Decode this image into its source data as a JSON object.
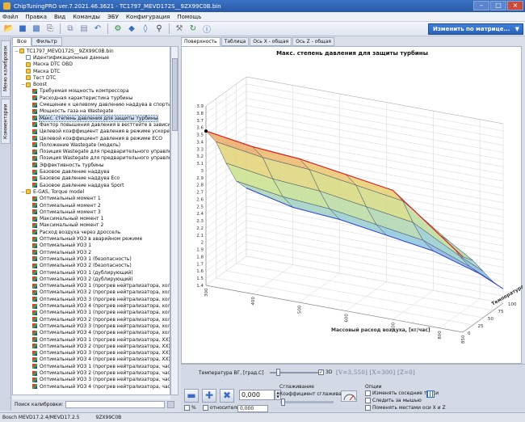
{
  "window": {
    "title": "ChipTuningPRO ver.7.2021.46.3621 - TC1797_MEVD172S__9ZX99C0B.bin"
  },
  "menu": [
    "Файл",
    "Правка",
    "Вид",
    "Команды",
    "ЭБУ",
    "Конфигурация",
    "Помощь"
  ],
  "toolbar": {
    "icons": [
      "open-folder-icon",
      "save-icon",
      "save-as-icon",
      "print-icon",
      "copy-icon",
      "paste-icon",
      "undo-icon",
      "connect-icon",
      "checksum-icon",
      "compare-icon",
      "search-icon",
      "settings-icon",
      "refresh-icon",
      "help-icon"
    ],
    "change_matrix_label": "Изменить по матрице..."
  },
  "side_tabs": [
    "Меню калибровок",
    "Комментарии"
  ],
  "left_tabs": [
    "Все",
    "Фильтр"
  ],
  "tree": [
    {
      "label": "TC1797_MEVD172S__9ZX99C0B.bin",
      "level": 0,
      "icon": "folder",
      "exp": "−"
    },
    {
      "label": "Идентификационные данные",
      "level": 1,
      "icon": "doc",
      "exp": ""
    },
    {
      "label": "Маска DTC OBD",
      "level": 1,
      "icon": "folder",
      "exp": ""
    },
    {
      "label": "Маска DTC",
      "level": 1,
      "icon": "folder",
      "exp": ""
    },
    {
      "label": "Тест DTC",
      "level": 1,
      "icon": "folder",
      "exp": ""
    },
    {
      "label": "Boost",
      "level": 1,
      "icon": "folder",
      "exp": "−"
    },
    {
      "label": "Требуемая мощность компрессора",
      "level": 2,
      "icon": "map",
      "exp": ""
    },
    {
      "label": "Расходная характеристика турбины",
      "level": 2,
      "icon": "map",
      "exp": ""
    },
    {
      "label": "Смещение к целевому давлению наддува в спортивном р",
      "level": 2,
      "icon": "map",
      "exp": ""
    },
    {
      "label": "Мощность газа на Wastegate",
      "level": 2,
      "icon": "map",
      "exp": ""
    },
    {
      "label": "Макс. степень давления для защиты турбины",
      "level": 2,
      "icon": "map",
      "exp": "",
      "selected": true
    },
    {
      "label": "Фактор повышения давления в вестгейте в зависимости",
      "level": 2,
      "icon": "map",
      "exp": ""
    },
    {
      "label": "Целевой коэффициент давления в режиме ускорения",
      "level": 2,
      "icon": "map",
      "exp": ""
    },
    {
      "label": "Целевой коэффициент давления в режиме ECO",
      "level": 2,
      "icon": "map",
      "exp": ""
    },
    {
      "label": "Положение Wastegate (модель)",
      "level": 2,
      "icon": "map",
      "exp": ""
    },
    {
      "label": "Позиция Wastegate для предварительного управления",
      "level": 2,
      "icon": "map",
      "exp": ""
    },
    {
      "label": "Позиция Wastegate для предварительного управления В",
      "level": 2,
      "icon": "map",
      "exp": ""
    },
    {
      "label": "Эффективность турбины",
      "level": 2,
      "icon": "map",
      "exp": ""
    },
    {
      "label": "Базовое давление наддува",
      "level": 2,
      "icon": "map",
      "exp": ""
    },
    {
      "label": "Базовое давление наддува Eco",
      "level": 2,
      "icon": "map",
      "exp": ""
    },
    {
      "label": "Базовое давление наддува Sport",
      "level": 2,
      "icon": "map",
      "exp": ""
    },
    {
      "label": "E-GAS, Torque model",
      "level": 1,
      "icon": "folder",
      "exp": "−"
    },
    {
      "label": "Оптимальный момент 1",
      "level": 2,
      "icon": "map",
      "exp": ""
    },
    {
      "label": "Оптимальный момент 2",
      "level": 2,
      "icon": "map",
      "exp": ""
    },
    {
      "label": "Оптимальный момент 3",
      "level": 2,
      "icon": "map",
      "exp": ""
    },
    {
      "label": "Максимальный момент 1",
      "level": 2,
      "icon": "map",
      "exp": ""
    },
    {
      "label": "Максимальный момент 2",
      "level": 2,
      "icon": "map",
      "exp": ""
    },
    {
      "label": "Расход воздуха через дроссель",
      "level": 2,
      "icon": "map",
      "exp": ""
    },
    {
      "label": "Оптимальный УОЗ в аварийном режиме",
      "level": 2,
      "icon": "map",
      "exp": ""
    },
    {
      "label": "Оптимальный УОЗ 1",
      "level": 2,
      "icon": "map",
      "exp": ""
    },
    {
      "label": "Оптимальный УОЗ 2",
      "level": 2,
      "icon": "map",
      "exp": ""
    },
    {
      "label": "Оптимальный УОЗ 1 (безопасность)",
      "level": 2,
      "icon": "map",
      "exp": ""
    },
    {
      "label": "Оптимальный УОЗ 2 (безопасность)",
      "level": 2,
      "icon": "map",
      "exp": ""
    },
    {
      "label": "Оптимальный УОЗ 1 (дублирующий)",
      "level": 2,
      "icon": "map",
      "exp": ""
    },
    {
      "label": "Оптимальный УОЗ 2 (дублирующий)",
      "level": 2,
      "icon": "map",
      "exp": ""
    },
    {
      "label": "Оптимальный УОЗ 1 (прогрев нейтрализатора, холодны",
      "level": 2,
      "icon": "map",
      "exp": ""
    },
    {
      "label": "Оптимальный УОЗ 2 (прогрев нейтрализатора, холодны",
      "level": 2,
      "icon": "map",
      "exp": ""
    },
    {
      "label": "Оптимальный УОЗ 3 (прогрев нейтрализатора, холодны",
      "level": 2,
      "icon": "map",
      "exp": ""
    },
    {
      "label": "Оптимальный УОЗ 4 (прогрев нейтрализатора, холодны",
      "level": 2,
      "icon": "map",
      "exp": ""
    },
    {
      "label": "Оптимальный УОЗ 1 (прогрев нейтрализатора, холодны",
      "level": 2,
      "icon": "map",
      "exp": ""
    },
    {
      "label": "Оптимальный УОЗ 2 (прогрев нейтрализатора, холодны",
      "level": 2,
      "icon": "map",
      "exp": ""
    },
    {
      "label": "Оптимальный УОЗ 3 (прогрев нейтрализатора, холодны",
      "level": 2,
      "icon": "map",
      "exp": ""
    },
    {
      "label": "Оптимальный УОЗ 4 (прогрев нейтрализатора, холодны",
      "level": 2,
      "icon": "map",
      "exp": ""
    },
    {
      "label": "Оптимальный УОЗ 1 (прогрев нейтрализатора, ХХ)",
      "level": 2,
      "icon": "map",
      "exp": ""
    },
    {
      "label": "Оптимальный УОЗ 2 (прогрев нейтрализатора, ХХ)",
      "level": 2,
      "icon": "map",
      "exp": ""
    },
    {
      "label": "Оптимальный УОЗ 3 (прогрев нейтрализатора, ХХ)",
      "level": 2,
      "icon": "map",
      "exp": ""
    },
    {
      "label": "Оптимальный УОЗ 4 (прогрев нейтрализатора, ХХ)",
      "level": 2,
      "icon": "map",
      "exp": ""
    },
    {
      "label": "Оптимальный УОЗ 1 (прогрев нейтрализатора, частична",
      "level": 2,
      "icon": "map",
      "exp": ""
    },
    {
      "label": "Оптимальный УОЗ 2 (прогрев нейтрализатора, частична",
      "level": 2,
      "icon": "map",
      "exp": ""
    },
    {
      "label": "Оптимальный УОЗ 3 (прогрев нейтрализатора, частична",
      "level": 2,
      "icon": "map",
      "exp": ""
    },
    {
      "label": "Оптимальный УОЗ 4 (прогрев нейтрализатора, частична",
      "level": 2,
      "icon": "map",
      "exp": ""
    }
  ],
  "search": {
    "label": "Поиск калибровки:",
    "value": ""
  },
  "view_tabs": [
    "Поверхность",
    "Таблица",
    "Ось X - общая",
    "Ось Z - общая"
  ],
  "chart_data": {
    "type": "surface3d",
    "title": "Макс. степень давления для защиты турбины",
    "xlabel": "Массовый расход воздуха, [кг/час]",
    "zlabel": "Температура ВГ, [°C]",
    "x_ticks": [
      "300",
      "400",
      "500",
      "600",
      "700",
      "800",
      "850"
    ],
    "z_ticks": [
      "0",
      "25",
      "50",
      "75",
      "100"
    ],
    "y_ticks": [
      "1.4",
      "1.5",
      "1.6",
      "1.7",
      "1.8",
      "1.9",
      "2",
      "2.1",
      "2.2",
      "2.3",
      "2.4",
      "2.5",
      "2.6",
      "2.7",
      "2.8",
      "2.9",
      "3",
      "3.1",
      "3.2",
      "3.3",
      "3.4",
      "3.5",
      "3.6",
      "3.7",
      "3.8",
      "3.9"
    ],
    "ylim": [
      1.4,
      3.9
    ],
    "x": [
      300,
      400,
      500,
      600,
      700,
      800,
      850
    ],
    "z": [
      0,
      25,
      50,
      75,
      100
    ],
    "values": [
      [
        3.55,
        3.3,
        2.9,
        2.55,
        2.35
      ],
      [
        3.45,
        3.2,
        2.8,
        2.45,
        2.2
      ],
      [
        3.4,
        3.15,
        2.75,
        2.4,
        2.15
      ],
      [
        3.3,
        3.05,
        2.65,
        2.3,
        2.05
      ],
      [
        3.2,
        2.95,
        2.55,
        2.2,
        1.95
      ],
      [
        2.7,
        2.5,
        2.2,
        1.95,
        1.75
      ],
      [
        2.45,
        2.3,
        2.05,
        1.8,
        1.6
      ]
    ]
  },
  "bottom": {
    "slider_label": "Температура ВГ, [град.С]",
    "check_3d_label": "3D",
    "coords_text": "[V=3,550] [X=300] [Z=0]",
    "value1": "0,000",
    "value2": "0,000",
    "value_small": "0,000",
    "percent_label": "%",
    "relative_label": "относительно",
    "smoothing_group": "Сглаживание",
    "smoothing_coef": "Коэффициент сглаживания",
    "options_group": "Опции",
    "opt1": "Изменять соседние точки",
    "opt2": "Следить за мышью",
    "opt3": "Поменять местами оси X и Z"
  },
  "status": [
    "Bosch MEVD17.2.4/MEVD17.2.5",
    "9ZX99C0B"
  ]
}
